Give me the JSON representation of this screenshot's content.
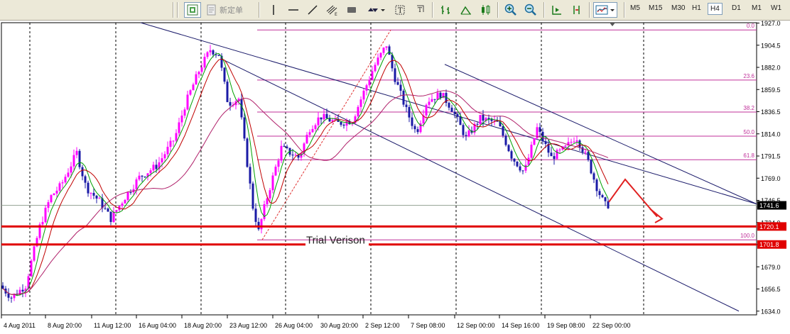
{
  "toolbar": {
    "new_order_label": "新定单",
    "timeframes": [
      "M5",
      "M15",
      "M30",
      "H1",
      "H4",
      "D1",
      "M1",
      "W1"
    ],
    "active_timeframe": "H4"
  },
  "chart_data": {
    "type": "candlestick",
    "symbol_hint": "XAUUSD",
    "y_ticks": [
      "1927.0",
      "1904.5",
      "1882.0",
      "1859.5",
      "1836.5",
      "1814.0",
      "1791.5",
      "1769.0",
      "1746.5",
      "1724.0",
      "1701.5",
      "1679.0",
      "1656.5",
      "1634.0"
    ],
    "y_range": [
      1634.0,
      1927.0
    ],
    "x_ticks": [
      "4 Aug 2011",
      "8 Aug 20:00",
      "11 Aug 12:00",
      "16 Aug 04:00",
      "18 Aug 20:00",
      "23 Aug 12:00",
      "26 Aug 04:00",
      "30 Aug 20:00",
      "2 Sep 12:00",
      "7 Sep 08:00",
      "12 Sep 00:00",
      "14 Sep 16:00",
      "19 Sep 08:00",
      "22 Sep 00:00"
    ],
    "current_price": "1741.6",
    "price_labels": [
      {
        "text": "1720.1",
        "value": 1720.1,
        "color": "#e00000"
      },
      {
        "text": "1701.8",
        "value": 1701.8,
        "color": "#e00000"
      }
    ],
    "fib_levels": [
      {
        "label": "0.0",
        "value": 1920.0
      },
      {
        "label": "23.6",
        "value": 1869.0
      },
      {
        "label": "38.2",
        "value": 1836.5
      },
      {
        "label": "50.0",
        "value": 1812.0
      },
      {
        "label": "61.8",
        "value": 1788.0
      },
      {
        "label": "100.0",
        "value": 1706.5
      }
    ],
    "support_lines": [
      1720.1,
      1701.8
    ],
    "watermark": "Trial Verison",
    "colors": {
      "bull": "#ff00ff",
      "bear": "#1a1aa6",
      "ma_fast": "#00a000",
      "ma_mid": "#c00000",
      "ma_slow": "#b0206a",
      "fib": "#c0309a",
      "channel": "#1a1a6a",
      "support": "#e00000",
      "arrow": "#e02020"
    }
  }
}
